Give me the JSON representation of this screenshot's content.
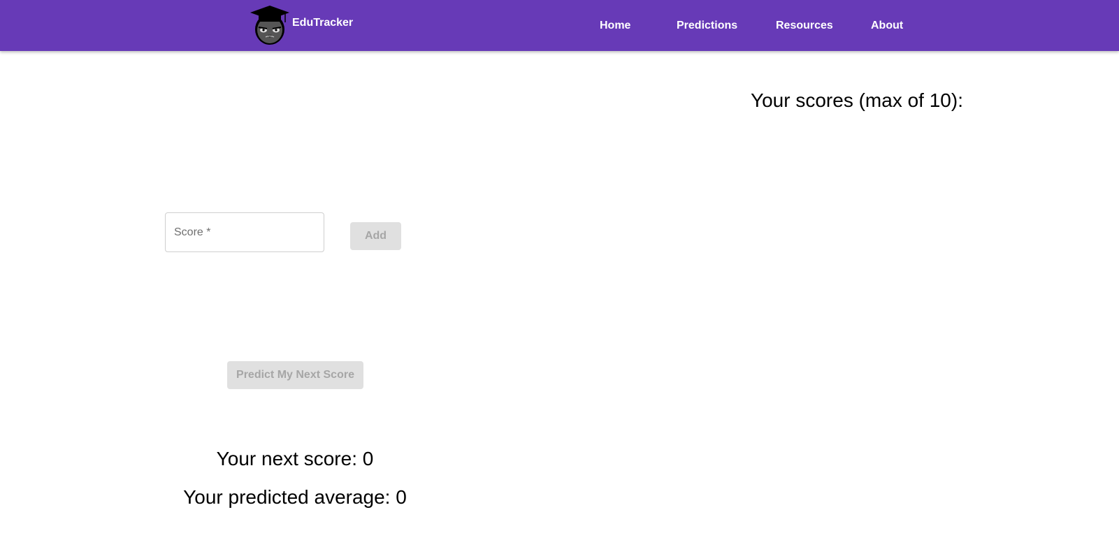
{
  "header": {
    "brand_name": "EduTracker",
    "logo_icon": "graduate-owl-logo",
    "background_color": "#673ab7",
    "nav": [
      {
        "label": "Home"
      },
      {
        "label": "Predictions"
      },
      {
        "label": "Resources"
      },
      {
        "label": "About"
      }
    ]
  },
  "form": {
    "score_placeholder": "Score *",
    "score_value": "",
    "add_label": "Add",
    "predict_label": "Predict My Next Score"
  },
  "scores_panel": {
    "heading": "Your scores (max of 10):",
    "items": []
  },
  "results": {
    "next_score": "Your next score: 0",
    "predicted_average": "Your predicted average: 0"
  }
}
